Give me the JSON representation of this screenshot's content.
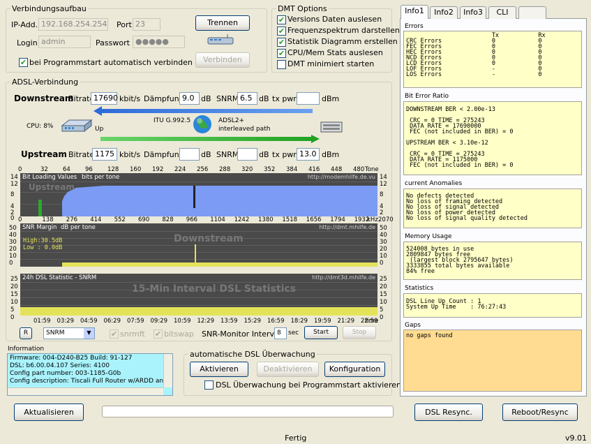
{
  "conn": {
    "title": "Verbindungsaufbau",
    "ip_label": "IP-Add.",
    "ip": "192.168.254.254",
    "port_label": "Port",
    "port": "23",
    "login_label": "Login",
    "login": "admin",
    "password_label": "Passwort",
    "password": "●●●●●",
    "disconnect": "Trennen",
    "connect": "Verbinden",
    "autoconnect": "bei Programmstart automatisch verbinden"
  },
  "dmt": {
    "title": "DMT Options",
    "options": [
      {
        "label": "Versions Daten auslesen",
        "checked": true
      },
      {
        "label": "Frequenzspektrum darstellen",
        "checked": true
      },
      {
        "label": "Statistik Diagramm erstellen",
        "checked": true
      },
      {
        "label": "CPU/Mem Stats auslesen",
        "checked": true
      },
      {
        "label": "DMT minimiert starten",
        "checked": false
      }
    ]
  },
  "adsl": {
    "title": "ADSL-Verbindung",
    "downstream": "Downstream",
    "upstream": "Upstream",
    "bitrate_label": "Bitrate",
    "kbits": "kbit/s",
    "damp_label": "Dämpfung",
    "db": "dB",
    "snrm_label": "SNRM",
    "txpwr_label": "tx pwr",
    "dbm": "dBm",
    "down_bitrate": "17690",
    "down_damp": "9.0",
    "down_snrm": "6.5",
    "down_txpwr": "",
    "up_bitrate": "1175",
    "up_damp": "",
    "up_snrm": "",
    "up_txpwr": "13.0",
    "cpu": "CPU: 8%",
    "up_text": "Up",
    "itu": "ITU G.992.5",
    "mode1": "ADSL2+",
    "mode2": "interleaved path"
  },
  "bitchart": {
    "label": "Bit Loading Values",
    "unit": "bits per tone",
    "url": "http://modemhilfe.de.vu",
    "wm": "Upstream",
    "tone_label": "Tone",
    "khz": "kHz",
    "top_ticks": [
      "0",
      "32",
      "64",
      "96",
      "128",
      "160",
      "192",
      "224",
      "256",
      "288",
      "320",
      "352",
      "384",
      "416",
      "448",
      "480"
    ],
    "bot_ticks": [
      "0",
      "138",
      "276",
      "414",
      "552",
      "690",
      "828",
      "966",
      "1104",
      "1242",
      "1380",
      "1518",
      "1656",
      "1794",
      "1932",
      "2070"
    ],
    "y_ticks": [
      "14",
      "12",
      "8",
      "4",
      "2",
      "0"
    ],
    "y_ticks_r": [
      "14",
      "12",
      "8",
      "4",
      "2"
    ]
  },
  "snrchart": {
    "label": "SNR Margin",
    "unit": "dB per tone",
    "url": "http://dmt.mhilfe.de",
    "wm": "Downstream",
    "high": "High:30.5dB",
    "low": "Low : 0.0dB",
    "y_ticks": [
      "50",
      "40",
      "30",
      "20",
      "10",
      "0"
    ]
  },
  "statchart": {
    "label": "24h DSL Statistic  - SNRM",
    "url": "http://dmt3d.mhilfe.de",
    "wm": "15-Min Interval DSL Statistics",
    "y_ticks": [
      "25",
      "20",
      "15",
      "10",
      "5",
      "0"
    ],
    "time_ticks": [
      "01:59",
      "03:29",
      "04:59",
      "06:29",
      "07:59",
      "09:29",
      "10:59",
      "12:29",
      "13:59",
      "15:29",
      "16:59",
      "18:29",
      "19:59",
      "21:29",
      "22:59"
    ],
    "time_label": "time"
  },
  "controls": {
    "r_btn": "R",
    "select": "SNRM",
    "snrmft": "snrmft",
    "bitswap": "bitswap",
    "interval_label": "SNR-Monitor Interval:",
    "interval": "8",
    "sec": "sec",
    "start": "Start",
    "stop": "Stop"
  },
  "info": {
    "title": "Information",
    "lines": [
      "Firmware: 004-D240-B25   Build: 91-127",
      "DSL: b6.00.04.107  Series: 4100",
      "Config part number: 003-1185-G0b",
      "Config description: Tiscali Full Router w/ARDD and F"
    ]
  },
  "watch": {
    "title": "automatische DSL Überwachung",
    "activate": "Aktivieren",
    "deactivate": "Deaktivieren",
    "config": "Konfiguration",
    "autostart": "DSL Überwachung bei Programmstart aktivieren"
  },
  "bottom": {
    "refresh": "Aktualisieren",
    "resync": "DSL Resync.",
    "reboot": "Reboot/Resync",
    "status": "Fertig",
    "version": "v9.01"
  },
  "tabs": [
    "Info1",
    "Info2",
    "Info3",
    "CLI",
    ""
  ],
  "panels": {
    "errors_title": "Errors",
    "errors": "                        Tx           Rx\nCRC Errors              0            0\nFEC Errors              0            0\nHEC Errors              0            0\nNCD Errors              0            0\nLCD Errors              0            0\nLOF Errors              -            0\nLOS Errors              -            0",
    "ber_title": "Bit Error Ratio",
    "ber": "DOWNSTREAM BER < 2.00e-13\n\n CRC = 0 TIME = 275243\n DATA RATE = 17690000\n FEC (not included in BER) = 0\n\nUPSTREAM BER < 3.10e-12\n\n CRC = 0 TIME = 275243\n DATA RATE = 1175000\n FEC (not included in BER) = 0",
    "anom_title": "current Anomalies",
    "anom": "No defects detected\nNo loss of framing detected\nNo loss of signal detected\nNo loss of power detected\nNo loss of signal quality detected",
    "mem_title": "Memory Usage",
    "mem": "524008 bytes in use\n2809847 bytes free\n (largest block 2795647 bytes)\n3333855 total bytes available\n84% free",
    "stat_title": "Statistics",
    "stat": "DSL Line Up Count : 1\nSystem Up Time    : 76:27:43",
    "gaps_title": "Gaps",
    "gaps": "no gaps found"
  },
  "colors": {
    "bits": "#7b9bf5",
    "upbits": "#2ca82c",
    "snr": "#e3e35a",
    "stat": "#e3e35a",
    "panel": "#ffffc8",
    "gaps": "#ffdc91",
    "info": "#aaf3fc"
  }
}
